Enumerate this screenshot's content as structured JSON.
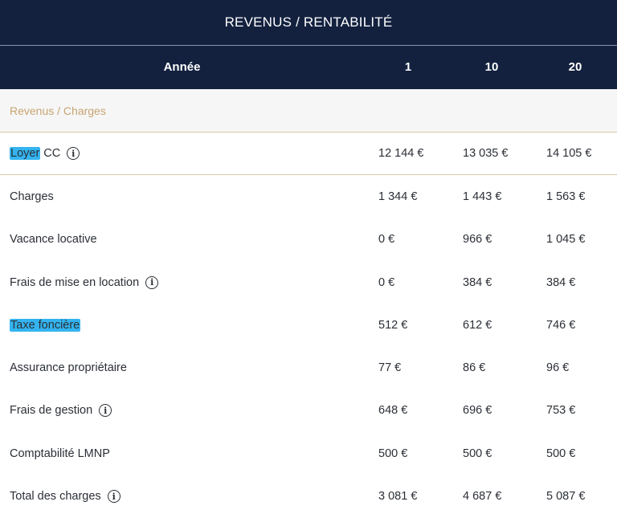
{
  "title": "REVENUS / RENTABILITÉ",
  "header": {
    "label": "Année",
    "columns": [
      "1",
      "10",
      "20"
    ]
  },
  "section_label": "Revenus / Charges",
  "info_symbol": "i",
  "rows": [
    {
      "label_highlight": "Loyer",
      "label_rest": " CC",
      "info": true,
      "values": [
        "12 144 €",
        "13 035 €",
        "14 105 €"
      ]
    },
    {
      "label": "Charges",
      "values": [
        "1 344 €",
        "1 443 €",
        "1 563 €"
      ]
    },
    {
      "label": "Vacance locative",
      "values": [
        "0 €",
        "966 €",
        "1 045 €"
      ]
    },
    {
      "label": "Frais de mise en location",
      "info": true,
      "values": [
        "0 €",
        "384 €",
        "384 €"
      ]
    },
    {
      "label_highlight": "Taxe foncière",
      "values": [
        "512 €",
        "612 €",
        "746 €"
      ]
    },
    {
      "label": "Assurance propriétaire",
      "values": [
        "77 €",
        "86 €",
        "96 €"
      ]
    },
    {
      "label": "Frais de gestion",
      "info": true,
      "values": [
        "648 €",
        "696 €",
        "753 €"
      ]
    },
    {
      "label": "Comptabilité LMNP",
      "values": [
        "500 €",
        "500 €",
        "500 €"
      ]
    },
    {
      "label": "Total des charges",
      "info": true,
      "values": [
        "3 081 €",
        "4 687 €",
        "5 087 €"
      ]
    }
  ],
  "colors": {
    "header_bg": "#13213f",
    "section_text": "#c8a572",
    "highlight": "#33b4f0"
  }
}
